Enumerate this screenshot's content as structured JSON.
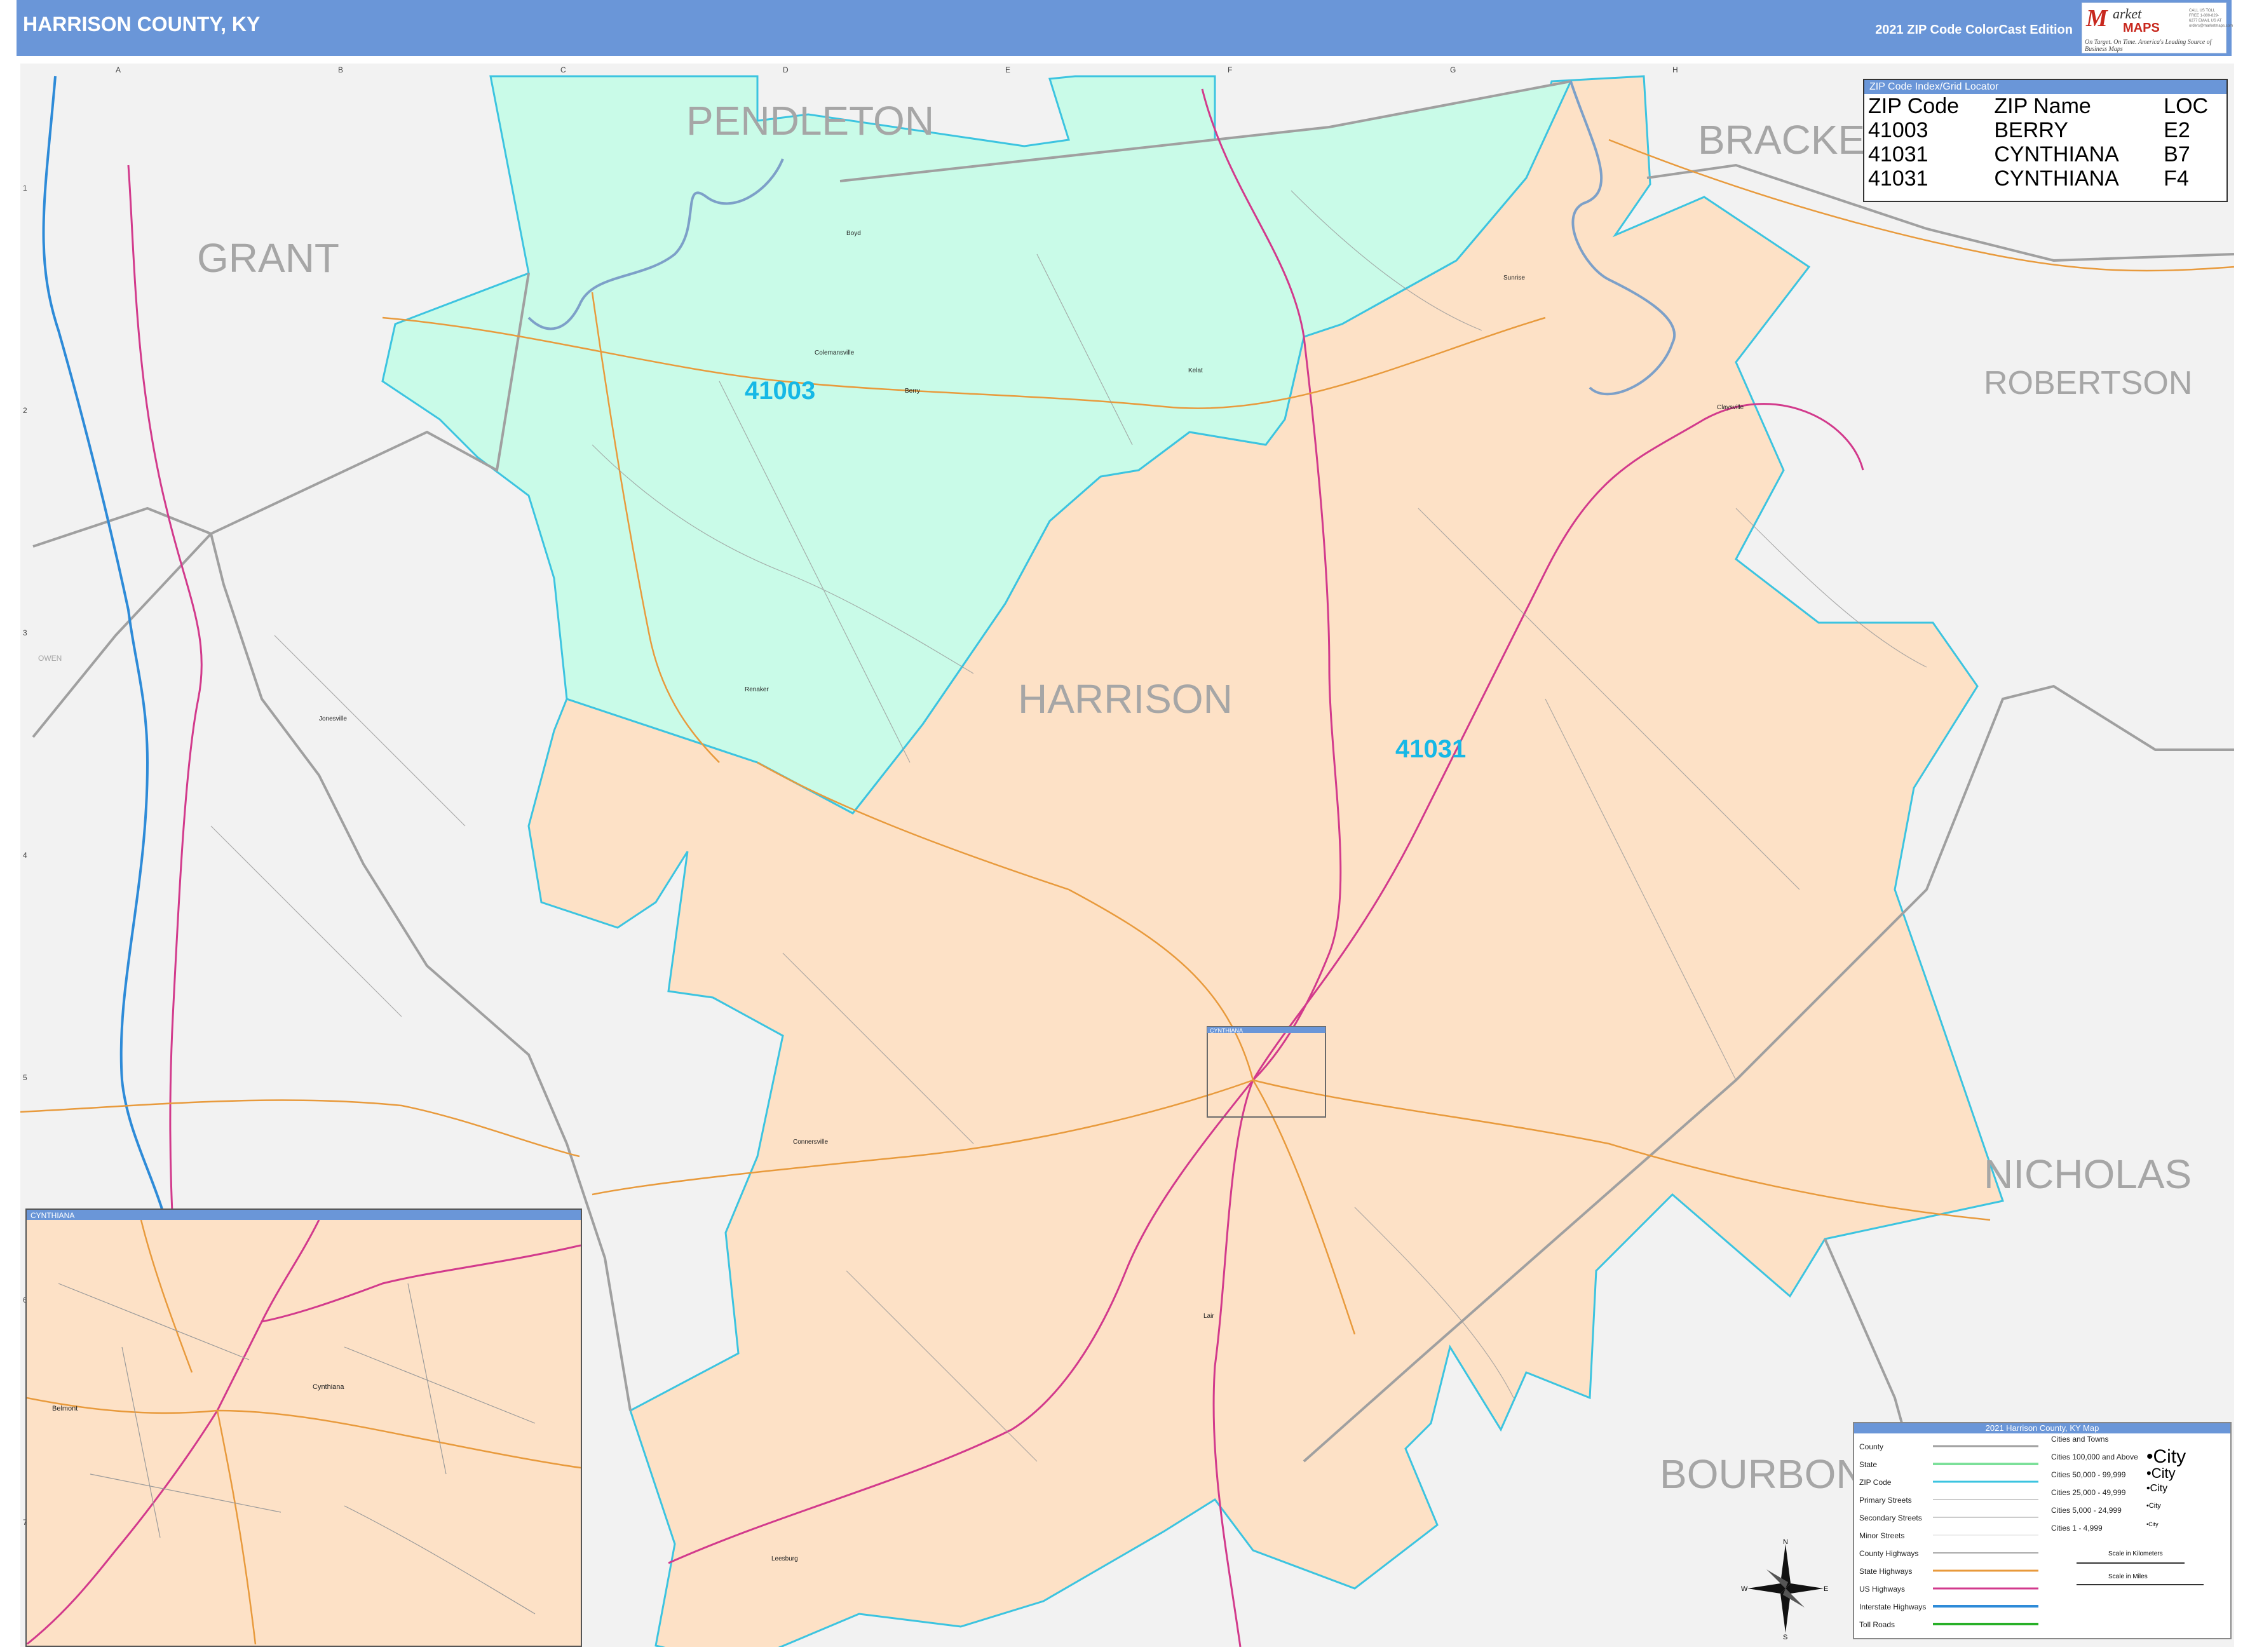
{
  "header": {
    "title": "HARRISON COUNTY, KY",
    "edition": "2021 ZIP Code ColorCast Edition"
  },
  "logo": {
    "line1": "M",
    "line2": "arket",
    "line3": "MAPS",
    "tagline": "On Target. On Time. America's Leading Source of Business Maps",
    "contact": "CALL US TOLL FREE 1-800-829-6277 EMAIL US AT orders@marketmaps.com"
  },
  "grid": {
    "columns": [
      "A",
      "B",
      "C",
      "D",
      "E",
      "F",
      "G",
      "H"
    ],
    "rows": [
      "1",
      "2",
      "3",
      "4",
      "5",
      "6",
      "7"
    ]
  },
  "counties": {
    "pendleton": "PENDLETON",
    "grant": "GRANT",
    "bracken": "BRACKE",
    "robertson": "ROBERTSON",
    "harrison": "HARRISON",
    "nicholas": "NICHOLAS",
    "bourbon": "BOURBON",
    "owen": "OWEN"
  },
  "zip_labels": {
    "z41003": "41003",
    "z41031": "41031"
  },
  "towns": {
    "boyd": "Boyd",
    "colemansville": "Colemansville",
    "berry": "Berry",
    "kelat": "Kelat",
    "sunrise": "Sunrise",
    "claysville": "Claysville",
    "renaker": "Renaker",
    "jonesville": "Jonesville",
    "connersville": "Connersville",
    "lair": "Lair",
    "leesburg": "Leesburg",
    "cynthiana": "Cynthiana",
    "belmont": "Belmont"
  },
  "zip_index": {
    "title": "ZIP Code Index/Grid Locator",
    "headers": [
      "ZIP Code",
      "ZIP Name",
      "LOC"
    ],
    "rows": [
      [
        "41003",
        "BERRY",
        "E2"
      ],
      [
        "41031",
        "CYNTHIANA",
        "B7"
      ],
      [
        "41031",
        "CYNTHIANA",
        "F4"
      ]
    ]
  },
  "inset": {
    "title": "CYNTHIANA",
    "marker_title": "CYNTHIANA"
  },
  "legend": {
    "title": "2021 Harrison County, KY Map",
    "items": [
      "County",
      "State",
      "ZIP Code",
      "Primary Streets",
      "Secondary Streets",
      "Minor Streets",
      "County Highways",
      "State Highways",
      "US Highways",
      "Interstate Highways",
      "Toll Roads"
    ],
    "cities_header": "Cities and Towns",
    "cities": [
      "Cities 100,000 and Above",
      "Cities 50,000 - 99,999",
      "Cities 25,000 - 49,999",
      "Cities 5,000 - 24,999",
      "Cities 1 - 4,999"
    ],
    "city_samples": [
      "•City",
      "•City",
      "•City",
      "•City",
      "•City"
    ],
    "scale_km": "Scale in Kilometers",
    "scale_mi": "Scale in Miles"
  },
  "compass": {
    "n": "N",
    "s": "S",
    "e": "E",
    "w": "W"
  },
  "colors": {
    "header": "#6a96d8",
    "zip_41003": "#c9fbe8",
    "zip_41031": "#fde1c6",
    "outside": "#f2f2f2",
    "zip_border": "#3cc4e0",
    "zip_label": "#16b8e6",
    "county_label": "#a6a6a6"
  }
}
